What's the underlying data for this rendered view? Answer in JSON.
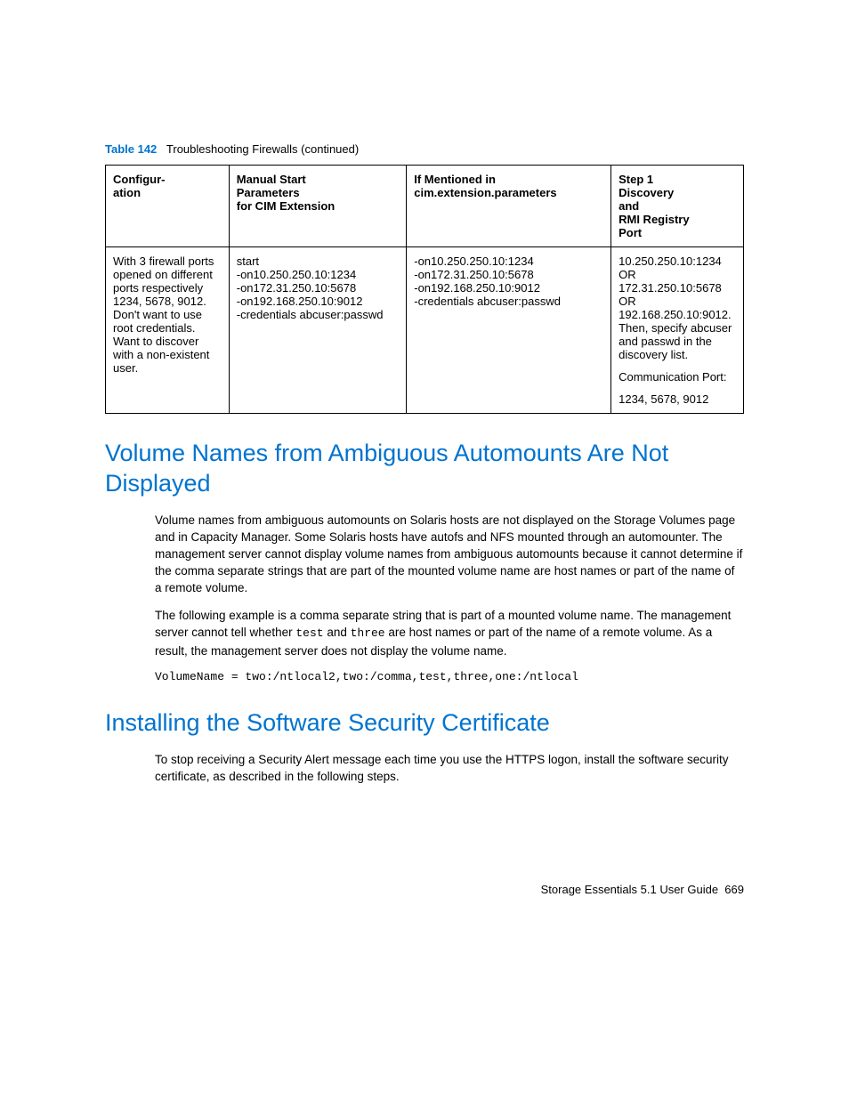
{
  "table_caption": {
    "label": "Table 142",
    "title": "Troubleshooting Firewalls (continued)"
  },
  "table": {
    "headers": {
      "c1": "Configur-\nation",
      "c2": "Manual Start\nParameters\nfor CIM Extension",
      "c3": "If Mentioned in\ncim.extension.parameters",
      "c4": "Step 1\nDiscovery\nand\nRMI Registry\nPort"
    },
    "row": {
      "c1": "With 3 firewall ports opened on different ports respectively 1234, 5678, 9012. Don't want to use root credentials. Want to discover with a non-existent user.",
      "c2": "start\n-on10.250.250.10:1234\n-on172.31.250.10:5678\n-on192.168.250.10:9012\n-credentials abcuser:passwd",
      "c3": "-on10.250.250.10:1234\n-on172.31.250.10:5678\n-on192.168.250.10:9012\n-credentials abcuser:passwd",
      "c4_p1": "10.250.250.10:1234 OR 172.31.250.10:5678 OR 192.168.250.10:9012. Then, specify abcuser and passwd in the discovery list.",
      "c4_p2": "Communication Port:",
      "c4_p3": "1234, 5678, 9012"
    }
  },
  "section1": {
    "heading": "Volume Names from Ambiguous Automounts Are Not Displayed",
    "p1": "Volume names from ambiguous automounts on Solaris hosts are not displayed on the Storage Volumes page and in Capacity Manager. Some Solaris hosts have autofs and NFS mounted through an automounter. The management server cannot display volume names from ambiguous automounts because it cannot determine if the comma separate strings that are part of the mounted volume name are host names or part of the name of a remote volume.",
    "p2_a": "The following example is a comma separate string that is part of a mounted volume name. The management server cannot tell whether ",
    "p2_code1": "test",
    "p2_b": " and ",
    "p2_code2": "three",
    "p2_c": " are host names or part of the name of a remote volume. As a result, the management server does not display the volume name.",
    "code": "VolumeName = two:/ntlocal2,two:/comma,test,three,one:/ntlocal"
  },
  "section2": {
    "heading": "Installing the Software Security Certificate",
    "p1": "To stop receiving a Security Alert message each time you use the HTTPS logon, install the software security certificate, as described in the following steps."
  },
  "footer": {
    "title": "Storage Essentials 5.1 User Guide",
    "page": "669"
  }
}
